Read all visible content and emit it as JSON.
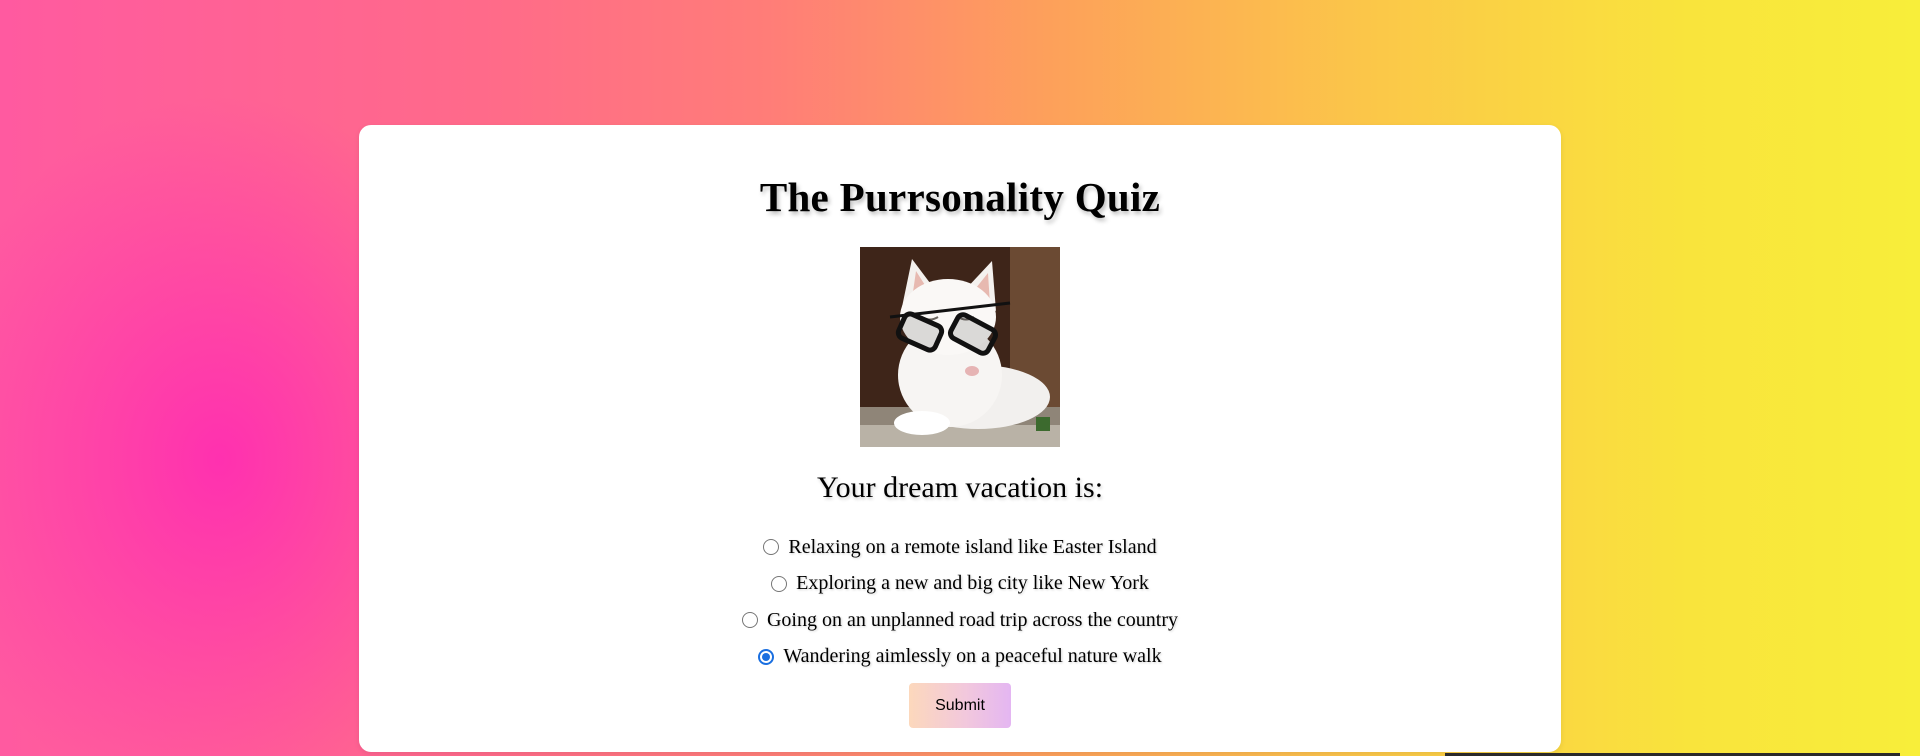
{
  "quiz": {
    "title": "The Purrsonality Quiz",
    "image_alt": "Cat wearing glasses",
    "question": "Your dream vacation is:",
    "options": [
      {
        "label": "Relaxing on a remote island like Easter Island",
        "selected": false
      },
      {
        "label": "Exploring a new and big city like New York",
        "selected": false
      },
      {
        "label": "Going on an unplanned road trip across the country",
        "selected": false
      },
      {
        "label": "Wandering aimlessly on a peaceful nature walk",
        "selected": true
      }
    ],
    "submit_label": "Submit"
  },
  "colors": {
    "background_left": "#ff3fb0",
    "background_right": "#f8ee3a",
    "card": "#ffffff",
    "radio_accent": "#1a6fe0",
    "button_gradient_start": "#fcd8bc",
    "button_gradient_end": "#e4b6f2"
  }
}
